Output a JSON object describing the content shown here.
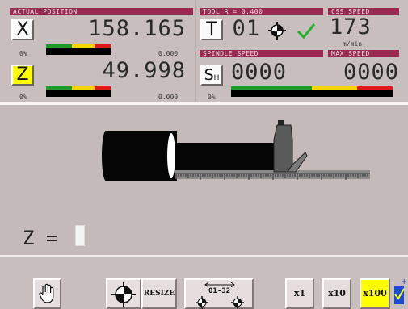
{
  "position": {
    "header": "ACTUAL POSITION",
    "x": {
      "axis": "X",
      "value": "158.165",
      "load_pct": "0%",
      "load_value": "0.000"
    },
    "z": {
      "axis": "Z",
      "value": "49.998",
      "load_pct": "0%",
      "load_value": "0.000"
    }
  },
  "tool": {
    "header": "TOOL  R = 0.400",
    "button": "T",
    "number": "01"
  },
  "css": {
    "header": "CSS SPEED",
    "value": "173",
    "unit": "m/min."
  },
  "spindle": {
    "header": "SPINDLE SPEED",
    "button": "S",
    "button_sub": "H",
    "value": "0000",
    "load_pct": "0%"
  },
  "max_speed": {
    "header": "MAX SPEED",
    "value": "0000"
  },
  "input": {
    "label": "Z ="
  },
  "toolbar": {
    "hand_icon": "hand-icon",
    "resize_label": "RESIZE",
    "range_label": "01-32",
    "x1_label": "x1",
    "x10_label": "x10",
    "x100_label": "x100"
  },
  "colors": {
    "header_bg": "#9b2a52",
    "bar_green": "#1f9a2a",
    "bar_yellow": "#f6d500",
    "bar_red": "#e01a1a",
    "active_button": "#ffff00",
    "check_green": "#22b02a"
  }
}
